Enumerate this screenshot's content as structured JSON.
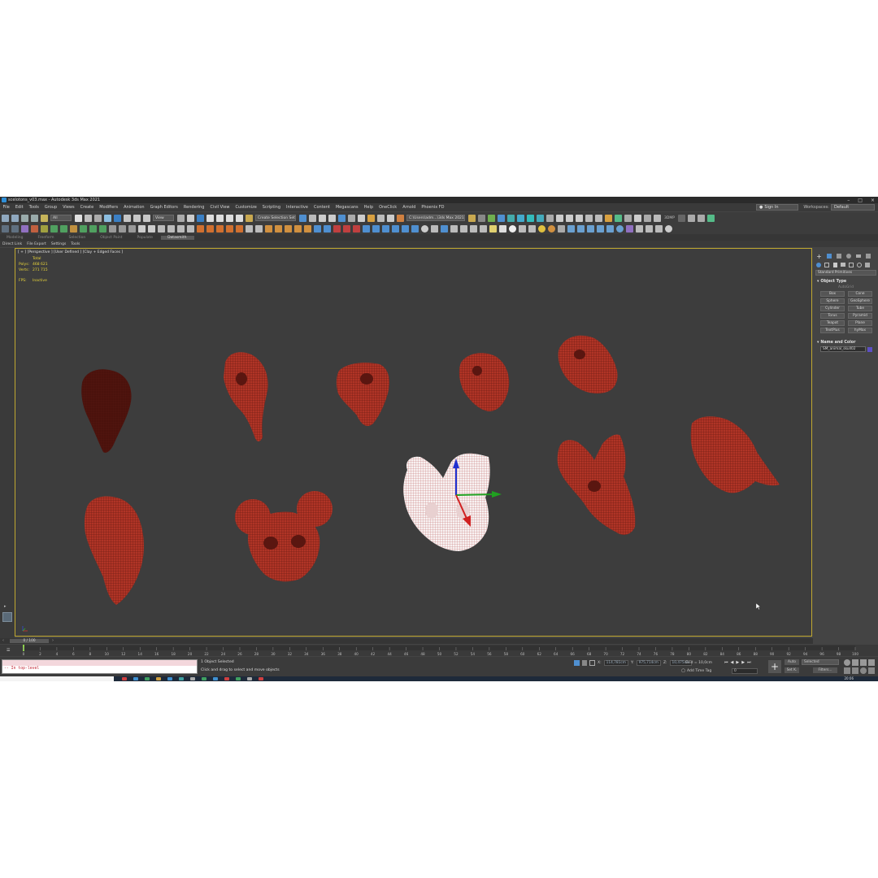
{
  "window": {
    "title": "scelotons_v03.max - Autodesk 3ds Max 2021"
  },
  "menu": [
    "File",
    "Edit",
    "Tools",
    "Group",
    "Views",
    "Create",
    "Modifiers",
    "Animation",
    "Graph Editors",
    "Rendering",
    "Civil View",
    "Customize",
    "Scripting",
    "Interactive",
    "Content",
    "Megascans",
    "Help",
    "OneClick",
    "Arnold",
    "Phoenix FD"
  ],
  "account": {
    "signin": "Sign In",
    "workspaces_label": "Workspaces:",
    "workspace": "Default"
  },
  "toolbar": {
    "filter_select": "All",
    "ref_coord": "View",
    "selection_set": "Create Selection Set",
    "project_path": "C:\\Users\\adm...\\3ds Max 2021",
    "label_3dmp": "3DMP"
  },
  "ribbon": {
    "tabs": [
      "Modeling",
      "Freeform",
      "Selection",
      "Object Paint",
      "Populate",
      "Datasmith"
    ],
    "active": 5,
    "sub_items": [
      "Direct Link",
      "File Export",
      "Settings",
      "Tools"
    ]
  },
  "viewport": {
    "label": "[ + ] [Perspective ] [User Defined ] [Clay + Edged Faces ]",
    "stats": [
      {
        "key": "",
        "value": "Total"
      },
      {
        "key": "Polys:",
        "value": "468 621"
      },
      {
        "key": "Verts:",
        "value": "271 715"
      }
    ],
    "fps_key": "FPS:",
    "fps_value": "Inactive",
    "skull_color": "#b03426",
    "selected_color": "#ffffff"
  },
  "command_panel": {
    "category": "Standard Primitives",
    "object_type_title": "Object Type",
    "autogrid": "AutoGrid",
    "buttons": [
      "Box",
      "Cone",
      "Sphere",
      "GeoSphere",
      "Cylinder",
      "Tube",
      "Torus",
      "Pyramid",
      "Teapot",
      "Plane",
      "TextPlus",
      "hyMax"
    ],
    "name_color_title": "Name and Color",
    "object_name": "SM_animal_skull02",
    "object_color": "#5d4fc4"
  },
  "timeline": {
    "frame": "0 / 100",
    "ticks": [
      0,
      2,
      4,
      6,
      8,
      10,
      12,
      14,
      16,
      18,
      20,
      22,
      24,
      26,
      28,
      30,
      32,
      34,
      36,
      38,
      40,
      42,
      44,
      46,
      48,
      50,
      52,
      54,
      56,
      58,
      60,
      62,
      64,
      66,
      68,
      70,
      72,
      74,
      76,
      78,
      80,
      82,
      84,
      86,
      88,
      90,
      92,
      94,
      96,
      98,
      100
    ]
  },
  "status": {
    "maxscript_line": "-- In top-level",
    "selection_msg": "1 Object Selected",
    "prompt_msg": "Click and drag to select and move objects",
    "x_label": "X:",
    "x": "114,781cm",
    "y_label": "Y:",
    "y": "975,714cm",
    "z_label": "Z:",
    "z": "10,475cm",
    "grid": "Grid = 10,0cm",
    "time_tag": "Add Time Tag",
    "current_frame": "0",
    "auto_key": "Auto",
    "set_key": "Set K.",
    "key_filter": "Selected",
    "filters": "Filters...",
    "clock": "20:06"
  }
}
